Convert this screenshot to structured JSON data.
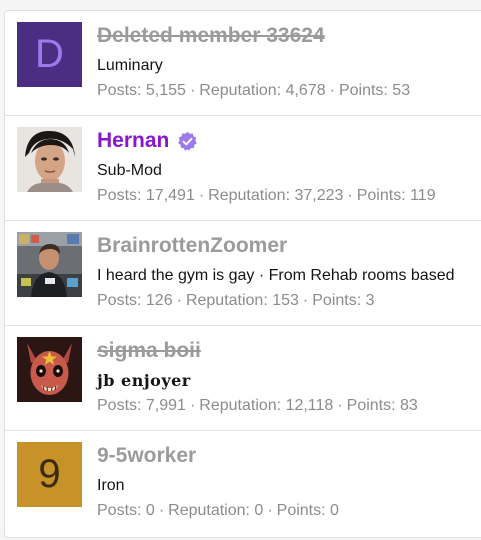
{
  "members": [
    {
      "name": "Deleted member 33624",
      "avatar_letter": "D",
      "avatar_bg": "#4b2e83",
      "avatar_fg": "#9b7bea",
      "title": "Luminary",
      "posts_label": "Posts: 5,155",
      "reputation_label": "Reputation: 4,678",
      "points_label": "Points: 53"
    },
    {
      "name": "Hernan",
      "verified": true,
      "title": "Sub-Mod",
      "posts_label": "Posts: 17,491",
      "reputation_label": "Reputation: 37,223",
      "points_label": "Points: 119"
    },
    {
      "name": "BrainrottenZoomer",
      "title": "I heard the gym is gay · From Rehab rooms based",
      "posts_label": "Posts: 126",
      "reputation_label": "Reputation: 153",
      "points_label": "Points: 3"
    },
    {
      "name": "sigma boii",
      "title": "jb enjoyer",
      "posts_label": "Posts: 7,991",
      "reputation_label": "Reputation: 12,118",
      "points_label": "Points: 83"
    },
    {
      "name": "9-5worker",
      "avatar_letter": "9",
      "avatar_bg": "#c8922a",
      "avatar_fg": "#3a2a0e",
      "title": "Iron",
      "posts_label": "Posts: 0",
      "reputation_label": "Reputation: 0",
      "points_label": "Points: 0"
    }
  ],
  "separator": "·",
  "colors": {
    "moderator_name": "#8a17c9",
    "verified_badge": "#9b7bea",
    "muted": "#8c8c8c"
  }
}
